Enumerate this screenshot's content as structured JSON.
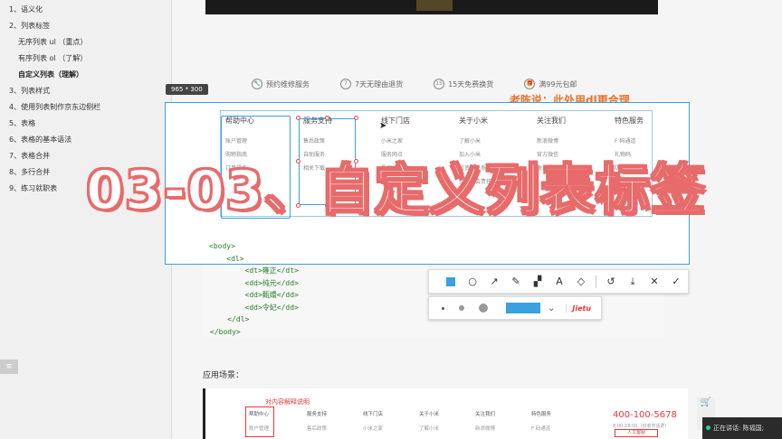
{
  "sidebar": {
    "items": [
      {
        "label": "1、语义化",
        "level": 1
      },
      {
        "label": "2、列表标签",
        "level": 1
      },
      {
        "label": "无序列表 ul （重点）",
        "level": 2
      },
      {
        "label": "有序列表 ol （了解）",
        "level": 2
      },
      {
        "label": "自定义列表（理解）",
        "level": 2,
        "active": true
      },
      {
        "label": "3、列表样式",
        "level": 1
      },
      {
        "label": "4、使用列表制作京东边侧栏",
        "level": 1
      },
      {
        "label": "5、表格",
        "level": 1
      },
      {
        "label": "6、表格的基本语法",
        "level": 1
      },
      {
        "label": "7、表格合并",
        "level": 1
      },
      {
        "label": "8、多行合并",
        "level": 1
      },
      {
        "label": "9、练习就职表",
        "level": 1
      }
    ],
    "toggle_icon": "menu-icon"
  },
  "services": [
    {
      "label": "预约维修服务",
      "icon": "wrench-icon"
    },
    {
      "label": "7天无理由退货",
      "icon": "seven-icon"
    },
    {
      "label": "15天免费换货",
      "icon": "fifteen-icon"
    },
    {
      "label": "满99元包邮",
      "icon": "gift-icon"
    }
  ],
  "annotation": "老陈说：此处用dl更合理",
  "capture": {
    "size_label": "965 * 300",
    "columns": [
      {
        "title": "帮助中心",
        "items": [
          "账户管理",
          "购物指南",
          "订单操作"
        ]
      },
      {
        "title": "服务支持",
        "items": [
          "售后政策",
          "自助服务",
          "相关下载"
        ]
      },
      {
        "title": "线下门店",
        "items": [
          "小米之家",
          "服务网点",
          "授权体验店"
        ]
      },
      {
        "title": "关于小米",
        "items": [
          "了解小米",
          "加入小米",
          "投资者关系",
          "企业社会责任"
        ]
      },
      {
        "title": "关注我们",
        "items": [
          "新浪微博",
          "官方微信",
          "联系我们"
        ]
      },
      {
        "title": "特色服务",
        "items": [
          "F 码通道",
          "礼物码",
          "防伪查询"
        ]
      }
    ],
    "code_lines": [
      "<body>",
      "    <dl>"
    ]
  },
  "code_block": {
    "lines": [
      "        <dt>雍正</dt>",
      "        <dd>纯元</dd>",
      "        <dd>甄嬛</dd>",
      "        <dd>令妃</dd>",
      "    </dl>",
      "</body>"
    ]
  },
  "toolbar": {
    "tools": [
      "rectangle-icon",
      "ellipse-icon",
      "arrow-icon",
      "pen-icon",
      "mosaic-icon",
      "text-icon",
      "eraser-icon",
      "undo-icon",
      "download-icon",
      "close-icon",
      "confirm-icon"
    ],
    "glyphs": [
      "",
      "○",
      "↗",
      "✎",
      "▞",
      "A",
      "◇",
      "↺",
      "⤓",
      "✕",
      "✓"
    ]
  },
  "subbar": {
    "brand": "Jietu",
    "dropdown_glyph": "⌄"
  },
  "overlay_title": "03-03、自定义列表标签",
  "scenario": {
    "title": "应用场景：",
    "label": "对内容解释说明",
    "columns": [
      {
        "title": "帮助中心",
        "sub": "账户管理"
      },
      {
        "title": "服务支持",
        "sub": "售后政策"
      },
      {
        "title": "线下门店",
        "sub": "小米之家"
      },
      {
        "title": "关于小米",
        "sub": "了解小米"
      },
      {
        "title": "关注我们",
        "sub": "新浪微博"
      },
      {
        "title": "特色服务",
        "sub": "F 码通道"
      }
    ],
    "phone": "400-100-5678",
    "hours": "8:00-18:00（仅收市话费）",
    "service_button": "人工客服"
  },
  "status": {
    "speaking": "正在讲话: 陈福国;"
  },
  "colors": {
    "accent": "#3aa0e0",
    "title_outline": "#e86b6b",
    "annotation": "#e8732c",
    "brand_red": "#e4393c"
  }
}
